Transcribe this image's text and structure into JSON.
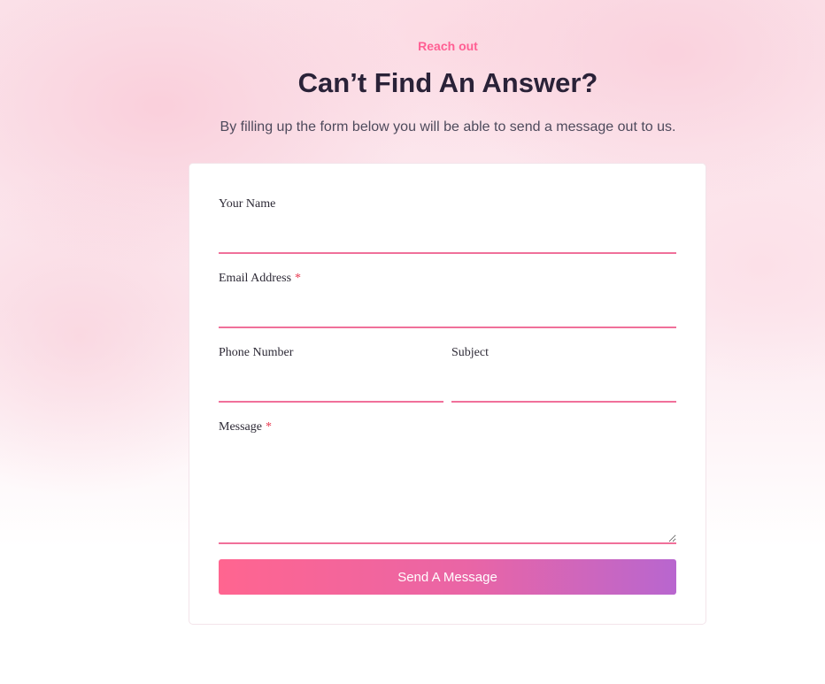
{
  "header": {
    "eyebrow": "Reach out",
    "title": "Can’t Find An Answer?",
    "subtitle": "By filling up the form below you will be able to send a message out to us."
  },
  "form": {
    "name": {
      "label": "Your Name",
      "value": ""
    },
    "email": {
      "label": "Email Address",
      "required_mark": "*",
      "value": ""
    },
    "phone": {
      "label": "Phone Number",
      "value": ""
    },
    "subject": {
      "label": "Subject",
      "value": ""
    },
    "message": {
      "label": "Message",
      "required_mark": "*",
      "value": ""
    },
    "submit_label": "Send A Message"
  },
  "colors": {
    "accent": "#ff5f93",
    "field_underline": "#f0709a",
    "required": "#e8384f",
    "button_gradient_start": "#ff6590",
    "button_gradient_end": "#b866cf",
    "title": "#2a2238"
  }
}
